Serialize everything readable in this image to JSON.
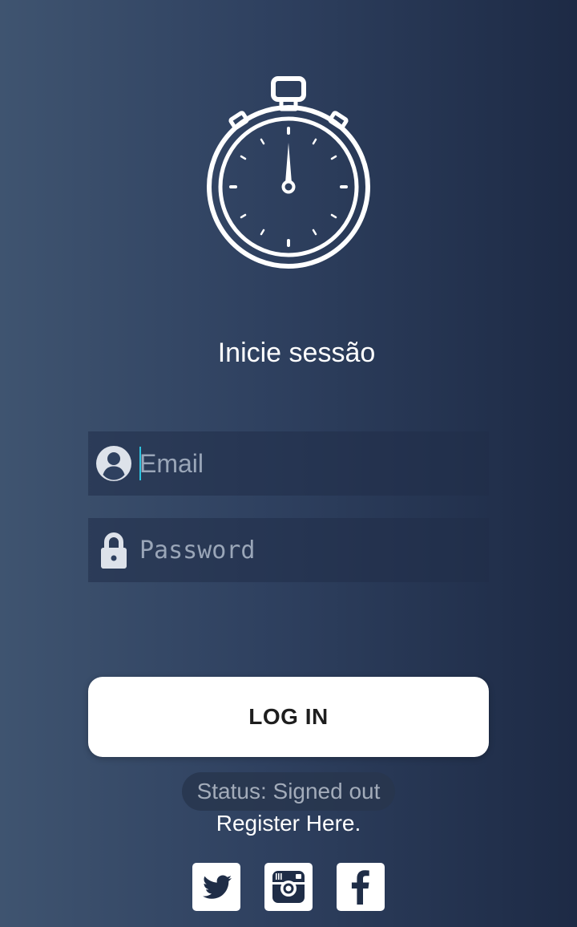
{
  "header": {
    "icon": "stopwatch-icon",
    "title": "Inicie sessão"
  },
  "form": {
    "email": {
      "icon": "user-circle-icon",
      "placeholder": "Email",
      "value": ""
    },
    "password": {
      "icon": "lock-icon",
      "placeholder": "Password",
      "value": ""
    },
    "login_label": "LOG IN"
  },
  "status": {
    "text": "Status: Signed out"
  },
  "register": {
    "label": "Register Here."
  },
  "social": [
    {
      "icon": "twitter-icon"
    },
    {
      "icon": "instagram-icon"
    },
    {
      "icon": "facebook-icon"
    }
  ],
  "colors": {
    "background_left": "#3f5470",
    "background_right": "#1d2a45",
    "button": "#ffffff",
    "caret": "#2ec4e0"
  }
}
